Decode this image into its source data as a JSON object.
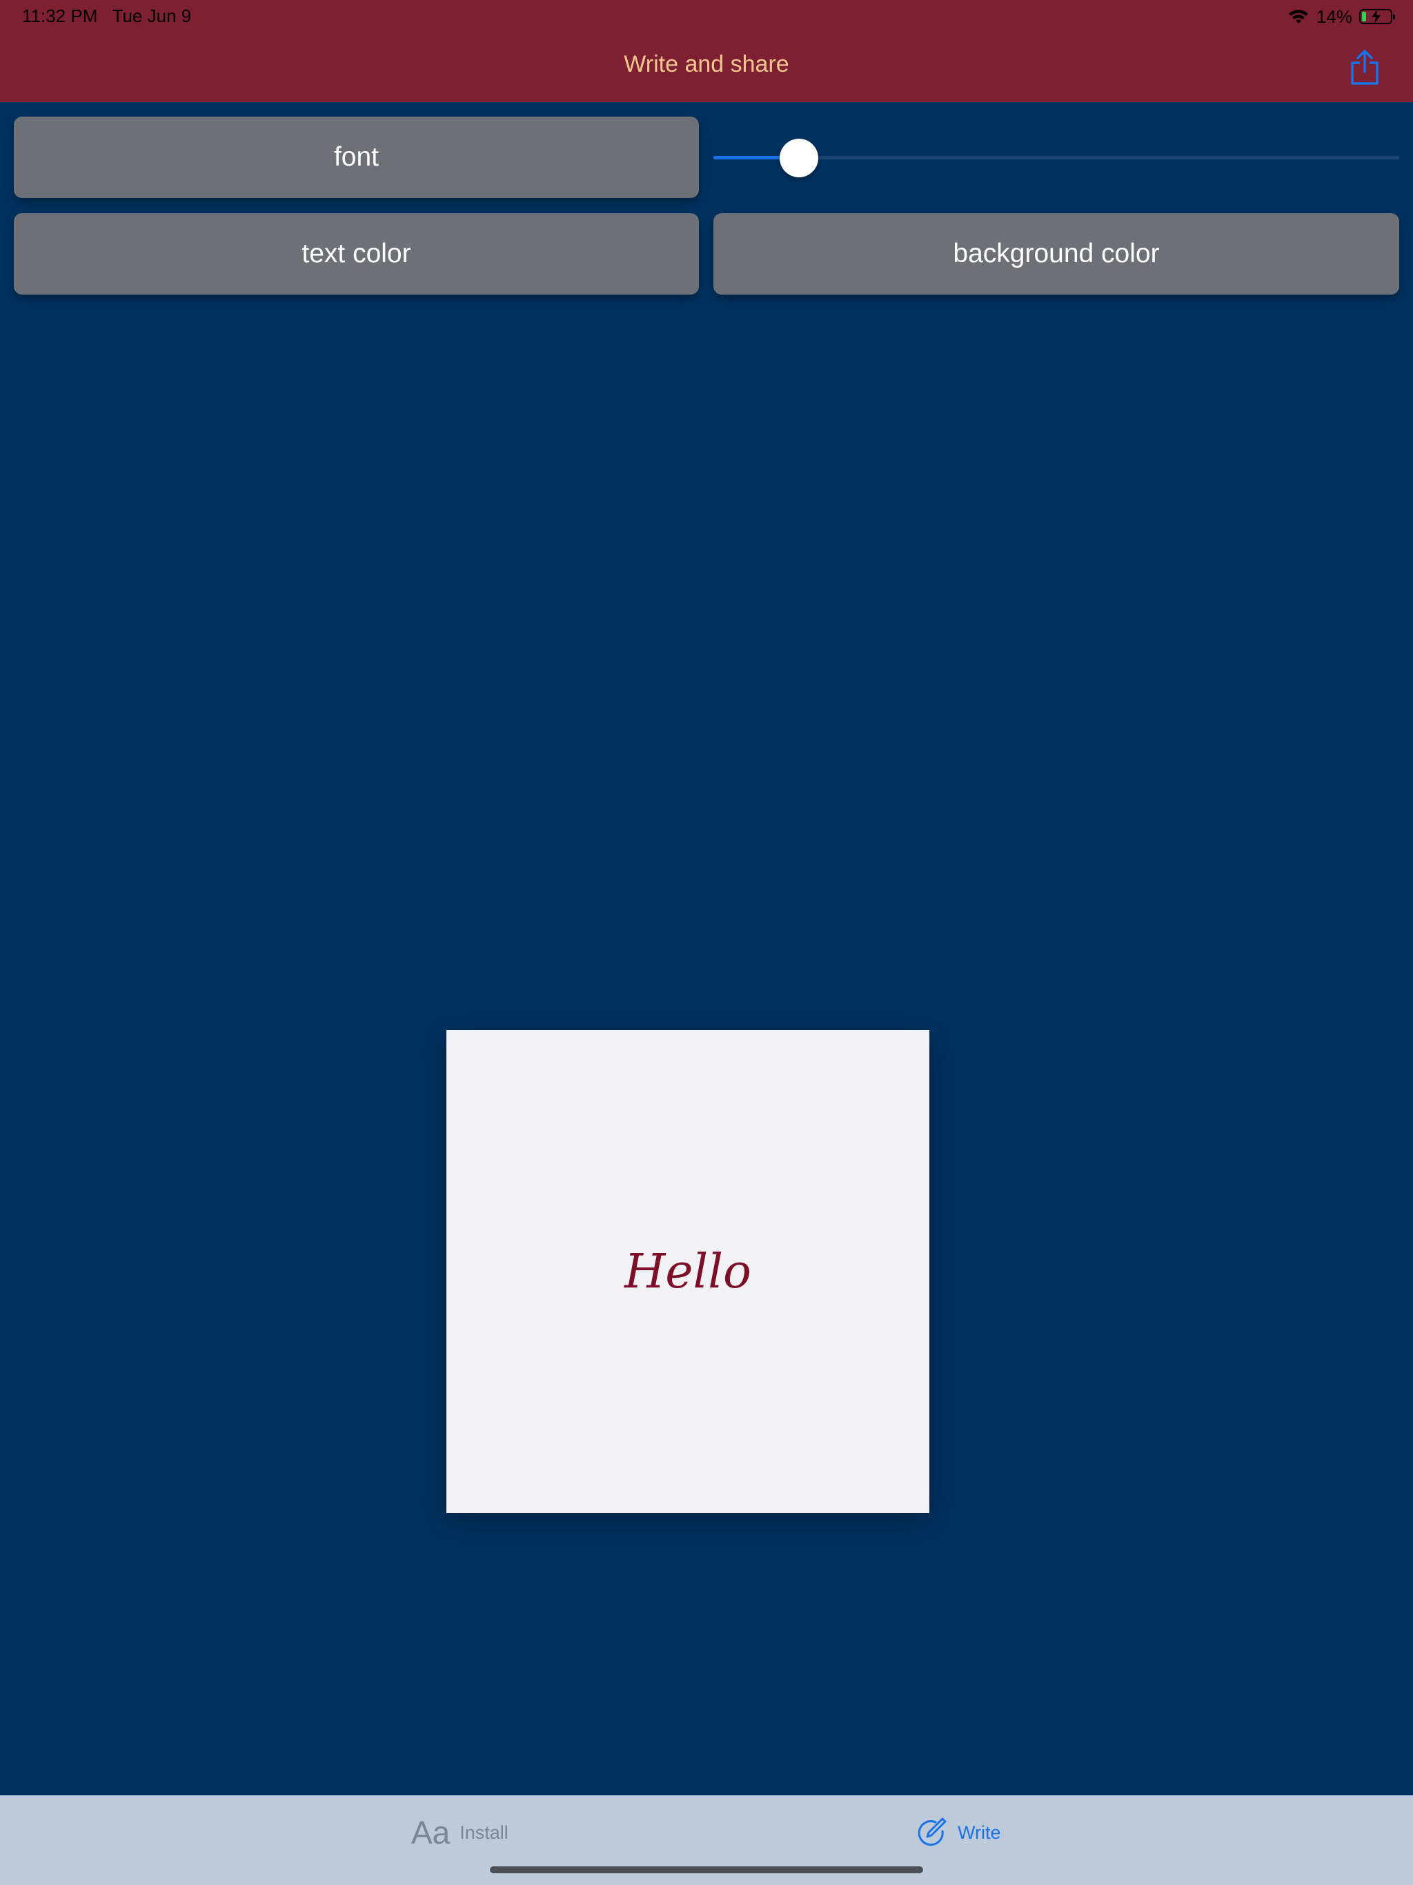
{
  "status_bar": {
    "time": "11:32 PM",
    "date": "Tue Jun 9",
    "battery": "14%",
    "battery_level": 0.14
  },
  "nav": {
    "title": "Write and share",
    "share_icon": "share-icon"
  },
  "controls": {
    "font_label": "font",
    "text_color_label": "text color",
    "background_color_label": "background color",
    "size_slider_value": 0.125
  },
  "canvas": {
    "text": "Hello",
    "text_color": "#7c1028",
    "background_color": "#f2f1f6"
  },
  "tabs": [
    {
      "icon": "Aa",
      "label": "Install",
      "selected": false
    },
    {
      "icon": "write-icon",
      "label": "Write",
      "selected": true
    }
  ],
  "colors": {
    "nav_background": "#7c2032",
    "nav_title": "#f3c690",
    "page_background": "#003260",
    "accent": "#1a73e8",
    "button": "#6e7077"
  }
}
